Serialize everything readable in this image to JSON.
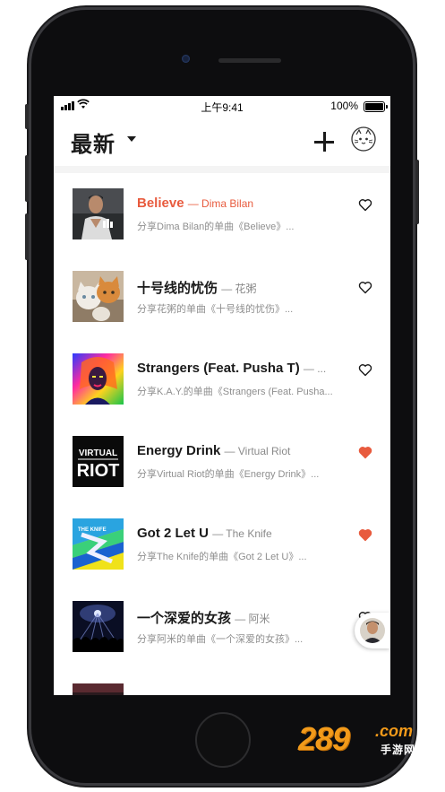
{
  "status_bar": {
    "time": "上午9:41",
    "battery": "100%"
  },
  "header": {
    "title": "最新"
  },
  "songs": [
    {
      "title": "Believe",
      "artist": "— Dima Bilan",
      "desc": "分享Dima Bilan的单曲《Believe》...",
      "liked": false,
      "active": true
    },
    {
      "title": "十号线的忧伤",
      "artist": "— 花粥",
      "desc": "分享花粥的单曲《十号线的忧伤》...",
      "liked": false,
      "active": false
    },
    {
      "title": "Strangers (Feat. Pusha T)",
      "artist": "— ...",
      "desc": "分享K.A.Y.的单曲《Strangers (Feat. Pusha...",
      "liked": false,
      "active": false
    },
    {
      "title": "Energy Drink",
      "artist": "— Virtual Riot",
      "desc": "分享Virtual Riot的单曲《Energy Drink》...",
      "liked": true,
      "active": false
    },
    {
      "title": "Got 2 Let U",
      "artist": "— The Knife",
      "desc": "分享The Knife的单曲《Got 2 Let U》...",
      "liked": true,
      "active": false
    },
    {
      "title": "一个深爱的女孩",
      "artist": "— 阿米",
      "desc": "分享阿米的单曲《一个深爱的女孩》...",
      "liked": false,
      "active": false
    }
  ],
  "covers": {
    "cover3_text_top": "VIRTUAL",
    "cover3_text_bottom": "RIOT",
    "cover4_text": "THE KNIFE"
  },
  "watermark": {
    "number": "289",
    "domain": ".com",
    "sub": "手游网"
  },
  "colors": {
    "accent": "#e85b3e",
    "heart_filled": "#e85b3e",
    "text": "#1a1a1a",
    "muted": "#8f8f8f"
  }
}
